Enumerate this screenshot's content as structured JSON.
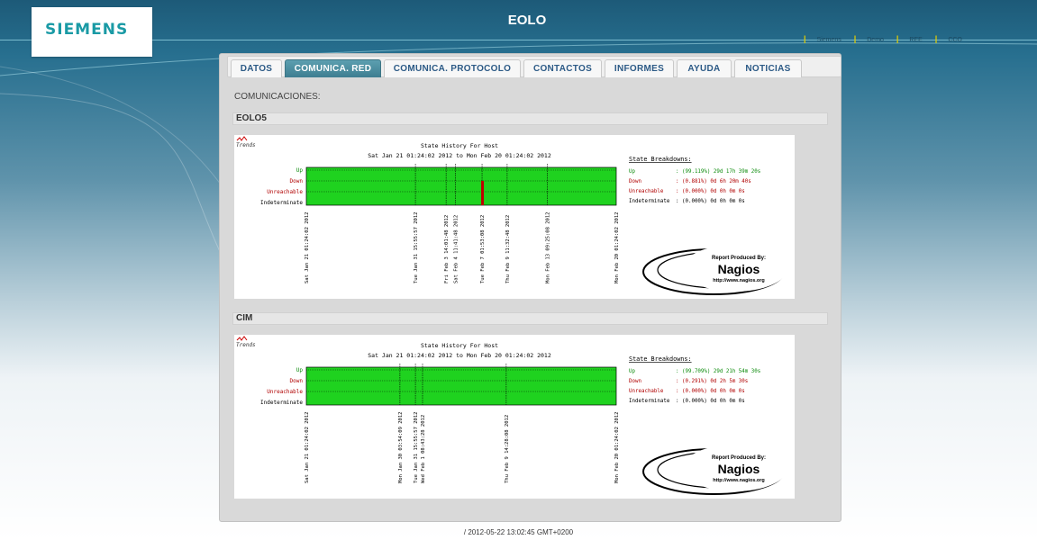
{
  "header": {
    "brand": "SIEMENS",
    "title": "EOLO",
    "links": [
      "Siemens",
      "Demo",
      "REE",
      "CCO"
    ]
  },
  "tabs": [
    {
      "label": "DATOS",
      "active": false
    },
    {
      "label": "COMUNICA. RED",
      "active": true
    },
    {
      "label": "COMUNICA. PROTOCOLO",
      "active": false
    },
    {
      "label": "CONTACTOS",
      "active": false
    },
    {
      "label": "INFORMES",
      "active": false
    },
    {
      "label": "AYUDA",
      "active": false
    },
    {
      "label": "NOTICIAS",
      "active": false
    }
  ],
  "section_label": "COMUNICACIONES:",
  "charts": [
    {
      "host": "EOLO5",
      "trends_label": "Trends",
      "title": "State History For Host",
      "range": "Sat Jan 21 01:24:02 2012 to Mon Feb 20 01:24:02 2012",
      "states": [
        "Up",
        "Down",
        "Unreachable",
        "Indeterminate"
      ],
      "breakdown_title": "State Breakdowns:",
      "breakdowns": [
        {
          "state": "Up",
          "value": ": (99.119%) 29d 17h 39m 20s",
          "color": "#0a8a0a"
        },
        {
          "state": "Down",
          "value": ": (0.881%) 0d 6h 20m 40s",
          "color": "#b00000"
        },
        {
          "state": "Unreachable",
          "value": ": (0.000%) 0d 0h 0m 0s",
          "color": "#b00000"
        },
        {
          "state": "Indeterminate",
          "value": ": (0.000%) 0d 0h 0m 0s",
          "color": "#000000"
        }
      ],
      "events": [
        {
          "label": "Sat Jan 21 01:24:02 2012",
          "fraction": 0.0,
          "kind": "edge"
        },
        {
          "label": "Tue Jan 31 15:55:57 2012",
          "fraction": 0.352,
          "kind": "event"
        },
        {
          "label": "Fri Feb  3 14:01:48 2012",
          "fraction": 0.451,
          "kind": "event"
        },
        {
          "label": "Sat Feb  4 11:41:48 2012",
          "fraction": 0.481,
          "kind": "event"
        },
        {
          "label": "Tue Feb  7 01:53:08 2012",
          "fraction": 0.567,
          "kind": "down"
        },
        {
          "label": "Thu Feb  9 11:32:48 2012",
          "fraction": 0.648,
          "kind": "event"
        },
        {
          "label": "Mon Feb 13 09:25:08 2012",
          "fraction": 0.778,
          "kind": "event"
        },
        {
          "label": "Mon Feb 20 01:24:02 2012",
          "fraction": 1.0,
          "kind": "edge"
        }
      ],
      "nagios": {
        "line1": "Report Produced By:",
        "line2": "Nagios",
        "line3": "http://www.nagios.org"
      }
    },
    {
      "host": "CIM",
      "trends_label": "Trends",
      "title": "State History For Host",
      "range": "Sat Jan 21 01:24:02 2012 to Mon Feb 20 01:24:02 2012",
      "states": [
        "Up",
        "Down",
        "Unreachable",
        "Indeterminate"
      ],
      "breakdown_title": "State Breakdowns:",
      "breakdowns": [
        {
          "state": "Up",
          "value": ": (99.709%) 29d 21h 54m 30s",
          "color": "#0a8a0a"
        },
        {
          "state": "Down",
          "value": ": (0.291%) 0d 2h 5m 30s",
          "color": "#b00000"
        },
        {
          "state": "Unreachable",
          "value": ": (0.000%) 0d 0h 0m 0s",
          "color": "#b00000"
        },
        {
          "state": "Indeterminate",
          "value": ": (0.000%) 0d 0h 0m 0s",
          "color": "#000000"
        }
      ],
      "events": [
        {
          "label": "Sat Jan 21 01:24:02 2012",
          "fraction": 0.0,
          "kind": "edge"
        },
        {
          "label": "Mon Jan 30 03:54:09 2012",
          "fraction": 0.302,
          "kind": "event"
        },
        {
          "label": "Tue Jan 31 15:55:57 2012",
          "fraction": 0.352,
          "kind": "event"
        },
        {
          "label": "Wed Feb  1 08:43:28 2012",
          "fraction": 0.375,
          "kind": "event"
        },
        {
          "label": "Thu Feb  9 14:28:08 2012",
          "fraction": 0.645,
          "kind": "event"
        },
        {
          "label": "Mon Feb 20 01:24:02 2012",
          "fraction": 1.0,
          "kind": "edge"
        }
      ],
      "nagios": {
        "line1": "Report Produced By:",
        "line2": "Nagios",
        "line3": "http://www.nagios.org"
      }
    }
  ],
  "footer": "/ 2012-05-22 13:02:45 GMT+0200"
}
